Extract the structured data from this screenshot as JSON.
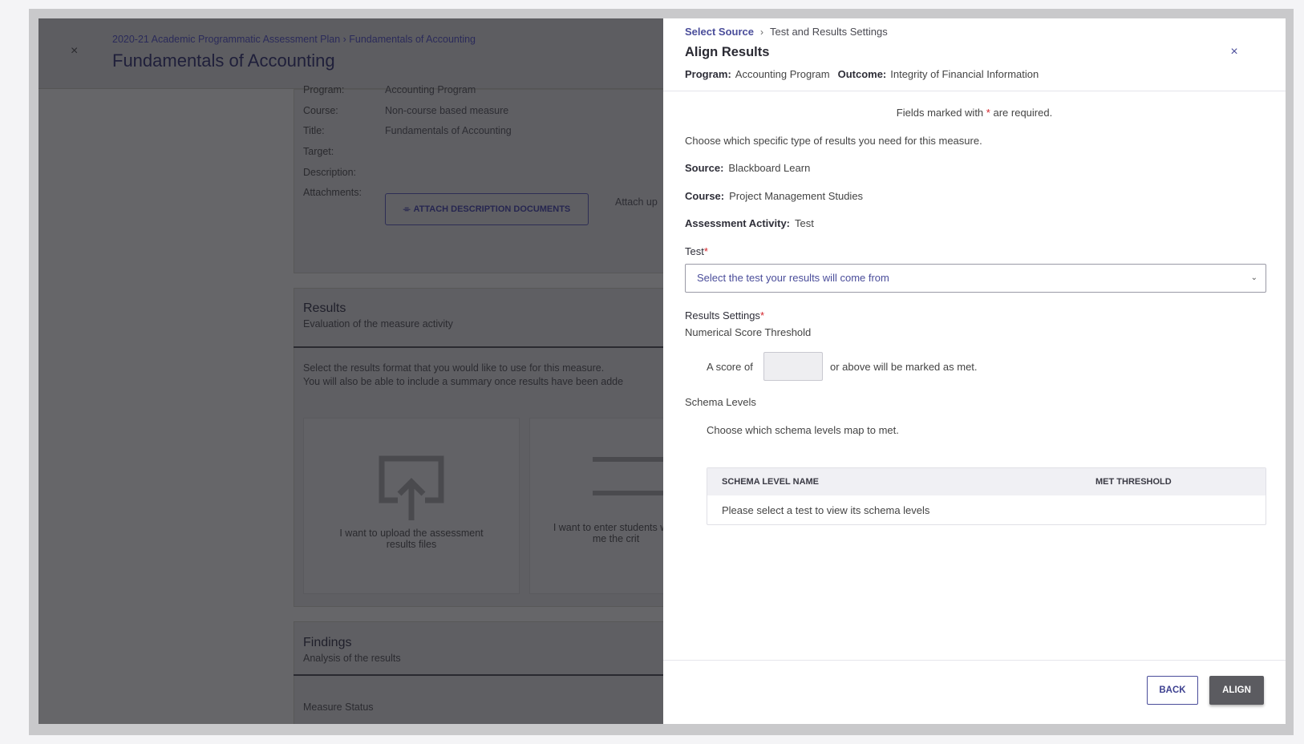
{
  "background": {
    "close_icon": "×",
    "breadcrumb": "2020-21 Academic Programmatic Assessment Plan › Fundamentals of Accounting",
    "title": "Fundamentals of Accounting",
    "details": {
      "program_label": "Program:",
      "program_value": "Accounting Program",
      "course_label": "Course:",
      "course_value": "Non-course based measure",
      "title_label": "Title:",
      "title_value": "Fundamentals of Accounting",
      "target_label": "Target:",
      "description_label": "Description:",
      "attachments_label": "Attachments:",
      "attach_button": "ATTACH DESCRIPTION DOCUMENTS",
      "attach_hint": "Attach up"
    },
    "results": {
      "heading": "Results",
      "subheading": "Evaluation of the measure activity",
      "line1": "Select the results format that you would like to use for this measure.",
      "line2": "You will also be able to include a summary once results have been adde",
      "option1": "I want to upload the assessment results files",
      "option2": "I want to enter students who me the crit"
    },
    "findings": {
      "heading": "Findings",
      "subheading": "Analysis of the results",
      "measure_status": "Measure Status"
    }
  },
  "drawer": {
    "breadcrumb": {
      "link": "Select Source",
      "separator": "›",
      "current": "Test and Results Settings"
    },
    "title": "Align Results",
    "meta": {
      "program_label": "Program:",
      "program_value": "Accounting Program",
      "outcome_label": "Outcome:",
      "outcome_value": "Integrity of Financial Information"
    },
    "close_icon": "×",
    "required_note_pre": "Fields marked with",
    "required_star": "*",
    "required_note_post": "are required.",
    "intro": "Choose which specific type of results you need for this measure.",
    "source_label": "Source:",
    "source_value": "Blackboard Learn",
    "course_label": "Course:",
    "course_value": "Project Management Studies",
    "activity_label": "Assessment Activity:",
    "activity_value": "Test",
    "test_label": "Test",
    "test_placeholder": "Select the test your results will come from",
    "results_settings_label": "Results Settings",
    "threshold_label": "Numerical Score Threshold",
    "score_prefix": "A score of",
    "score_value": "",
    "score_suffix": "or above will be marked as met.",
    "schema_levels_label": "Schema Levels",
    "schema_instruction": "Choose which schema levels map to met.",
    "table": {
      "col_name": "SCHEMA LEVEL NAME",
      "col_threshold": "MET THRESHOLD",
      "empty_text": "Please select a test to view its schema levels"
    },
    "back_button": "BACK",
    "align_button": "ALIGN"
  }
}
